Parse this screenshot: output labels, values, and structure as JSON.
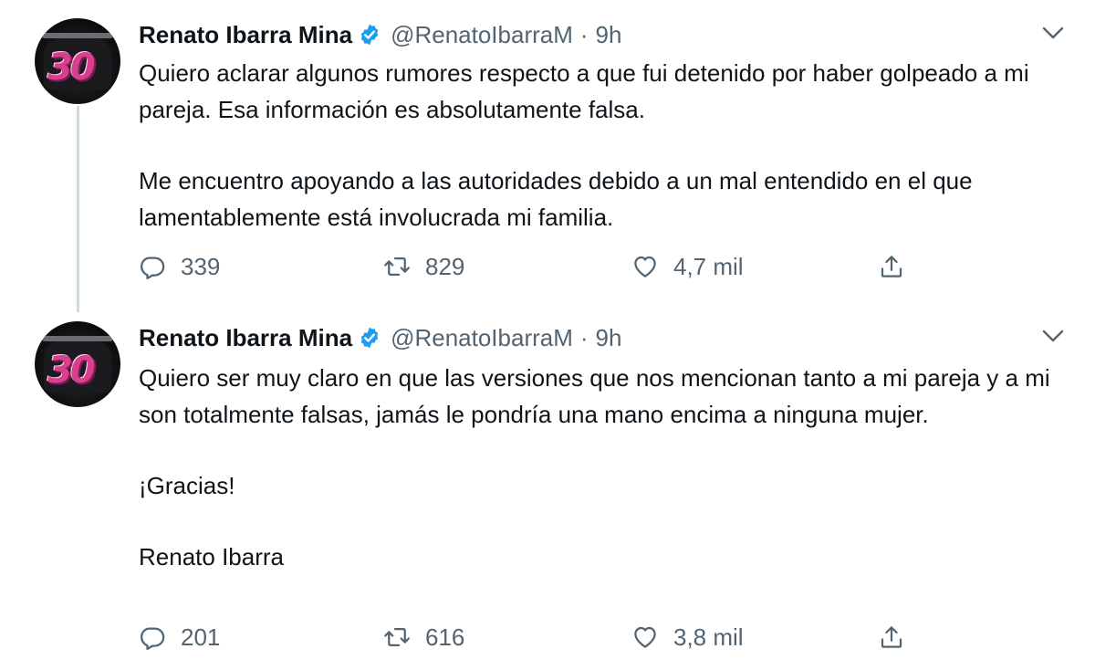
{
  "tweets": [
    {
      "author_name": "Renato Ibarra Mina",
      "handle": "@RenatoIbarraM",
      "separator": "·",
      "time": "9h",
      "paragraphs": [
        "Quiero aclarar algunos rumores respecto a que fui detenido por haber golpeado a mi pareja. Esa información es absolutamente falsa.",
        "Me encuentro apoyando a las autoridades debido a un mal entendido en el que lamentablemente está involucrada mi familia."
      ],
      "replies": "339",
      "retweets": "829",
      "likes": "4,7 mil"
    },
    {
      "author_name": "Renato Ibarra Mina",
      "handle": "@RenatoIbarraM",
      "separator": "·",
      "time": "9h",
      "paragraphs": [
        "Quiero ser muy claro en que las versiones que nos mencionan tanto a mi pareja y a mi son totalmente falsas, jamás le pondría una mano encima a ninguna mujer.",
        "¡Gracias!",
        "Renato Ibarra"
      ],
      "replies": "201",
      "retweets": "616",
      "likes": "3,8 mil"
    }
  ],
  "avatar_number": "30",
  "colors": {
    "verified": "#1d9bf0",
    "muted": "#536471",
    "text": "#0f1419",
    "thread_line": "#cfd9de",
    "avatar_accent": "#d93f8f"
  },
  "icons": {
    "verified": "verified-badge-icon",
    "more": "chevron-down-icon",
    "reply": "reply-icon",
    "retweet": "retweet-icon",
    "like": "heart-icon",
    "share": "share-icon"
  }
}
